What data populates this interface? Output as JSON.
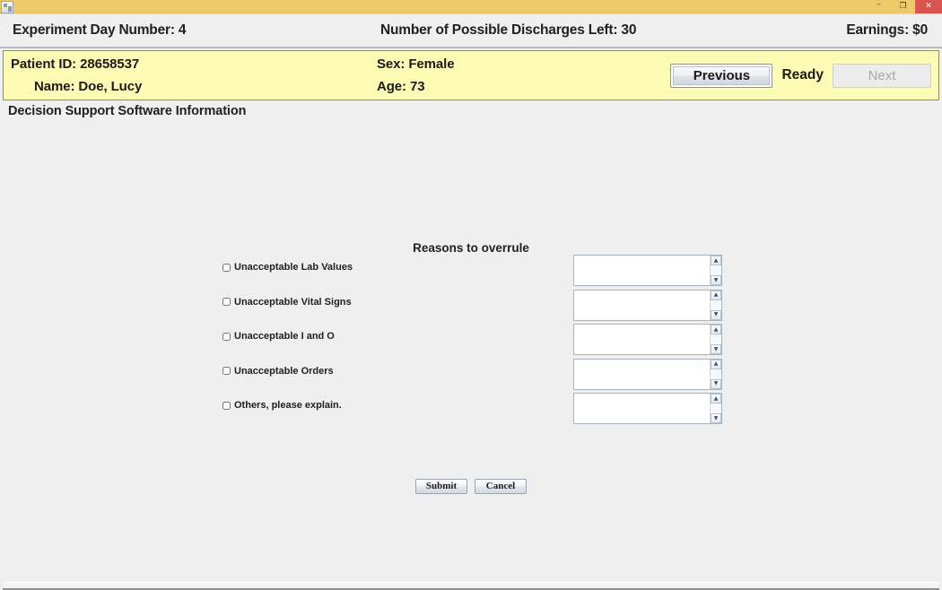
{
  "window": {
    "icon": "app-icon",
    "controls": {
      "minimize": "–",
      "restore": "❐",
      "close": "✕"
    }
  },
  "header": {
    "experiment_day": "Experiment Day Number: 4",
    "discharges_left": "Number of Possible Discharges Left: 30",
    "earnings": "Earnings: $0"
  },
  "patient": {
    "id_line": "Patient ID: 28658537",
    "name_line": "Name: Doe, Lucy",
    "sex_line": "Sex:  Female",
    "age_line": "Age: 73",
    "previous_label": "Previous",
    "status_label": "Ready",
    "next_label": "Next"
  },
  "content": {
    "dss_label": "Decision Support Software Information",
    "form_title": "Reasons to overrule",
    "reasons": [
      {
        "label": "Unacceptable Lab Values",
        "value": "",
        "placeholder": ""
      },
      {
        "label": "Unacceptable Vital Signs",
        "value": "",
        "placeholder": ""
      },
      {
        "label": "Unacceptable I and O",
        "value": "",
        "placeholder": ""
      },
      {
        "label": "Unacceptable Orders",
        "value": "",
        "placeholder": ""
      },
      {
        "label": "Others, please explain.",
        "value": "",
        "placeholder": ""
      }
    ],
    "submit_label": "Submit",
    "cancel_label": "Cancel",
    "scroll_up_glyph": "▲",
    "scroll_down_glyph": "▼"
  },
  "colors": {
    "titlebar": "#edc96a",
    "close_button": "#d9534f",
    "patient_bar": "#fcfcb4",
    "app_background": "#efefef"
  }
}
